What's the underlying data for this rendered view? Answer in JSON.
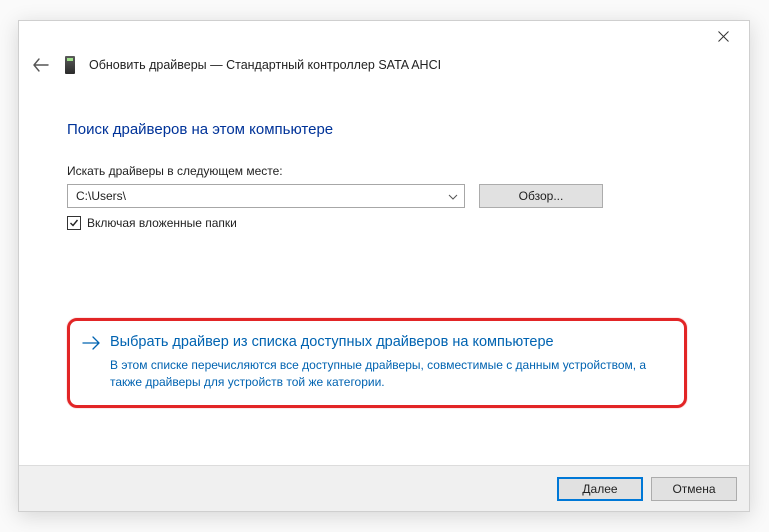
{
  "header": {
    "title": "Обновить драйверы — Стандартный контроллер SATA AHCI"
  },
  "heading": "Поиск драйверов на этом компьютере",
  "search": {
    "label": "Искать драйверы в следующем месте:",
    "path": "C:\\Users\\",
    "browse": "Обзор...",
    "include_subfolders": "Включая вложенные папки",
    "include_subfolders_checked": true
  },
  "option": {
    "title": "Выбрать драйвер из списка доступных драйверов на компьютере",
    "description": "В этом списке перечисляются все доступные драйверы, совместимые с данным устройством, а также драйверы для устройств той же категории."
  },
  "footer": {
    "next": "Далее",
    "cancel": "Отмена"
  }
}
